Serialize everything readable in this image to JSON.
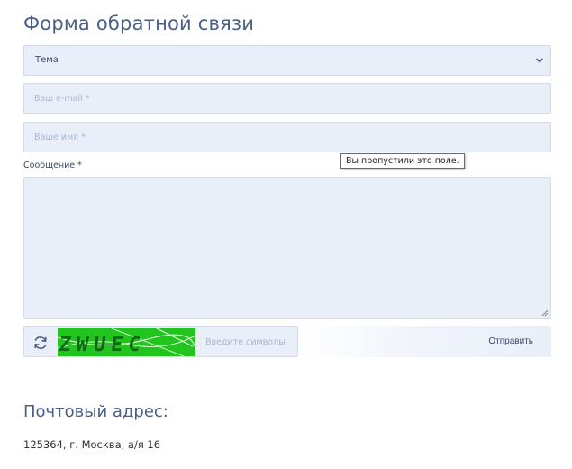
{
  "form": {
    "title": "Форма обратной связи",
    "topic": {
      "selected": "Тема",
      "icon": "chevron-down-icon"
    },
    "email": {
      "placeholder": "Ваш e-mail *"
    },
    "name": {
      "placeholder": "Ваше имя *"
    },
    "message": {
      "label": "Сообщение *"
    },
    "validation_tooltip": "Вы пропустили это поле.",
    "captcha": {
      "refresh_icon": "refresh-icon",
      "image_text": "ZWUEC",
      "placeholder": "Введите символы"
    },
    "submit_label": "Отправить"
  },
  "postal": {
    "title": "Почтовый адрес:",
    "address": "125364, г. Москва, а/я 16"
  },
  "colors": {
    "field_bg": "#e9eef9",
    "field_border": "#d3dbea",
    "heading": "#4a5f86",
    "placeholder": "#a7b6d4",
    "captcha_bg": "#22c41e"
  }
}
